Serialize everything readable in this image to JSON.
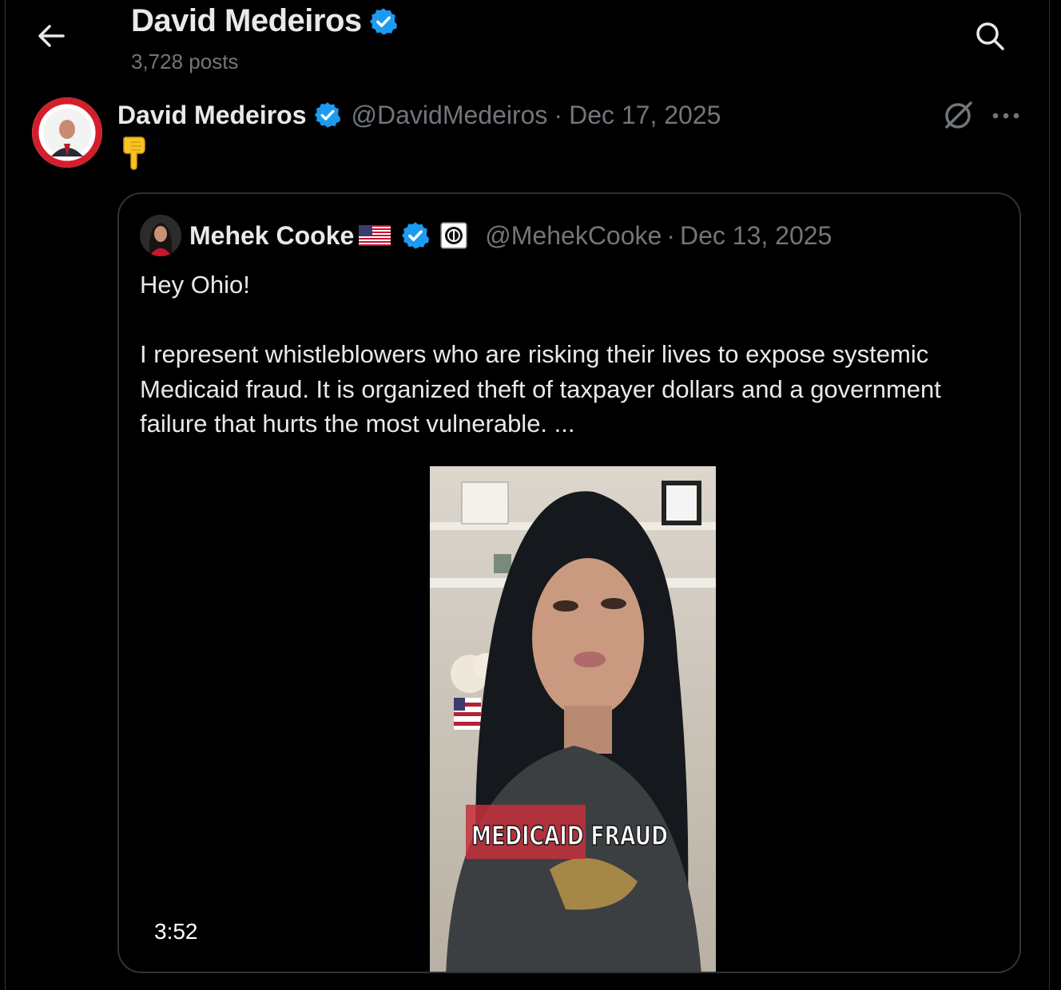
{
  "header": {
    "title": "David Medeiros",
    "posts_count": "3,728 posts"
  },
  "tweet": {
    "author_name": "David Medeiros",
    "handle": "@DavidMedeiros",
    "separator": "·",
    "date": "Dec 17, 2025",
    "body_emoji": "👇"
  },
  "quote": {
    "author_name": "Mehek Cooke",
    "handle": "@MehekCooke",
    "separator": "·",
    "date": "Dec 13, 2025",
    "text_line1": "Hey Ohio!",
    "text_para2": "I represent whistleblowers who are risking their lives to expose systemic Medicaid fraud. It is organized theft of taxpayer dollars and a government failure that hurts the most vulnerable. ...",
    "video": {
      "caption": "MEDICAID FRAUD",
      "duration": "3:52"
    }
  },
  "colors": {
    "background": "#000000",
    "text": "#e7e9ea",
    "muted": "#71767b",
    "verified": "#1d9bf0",
    "border": "#2f3336"
  }
}
